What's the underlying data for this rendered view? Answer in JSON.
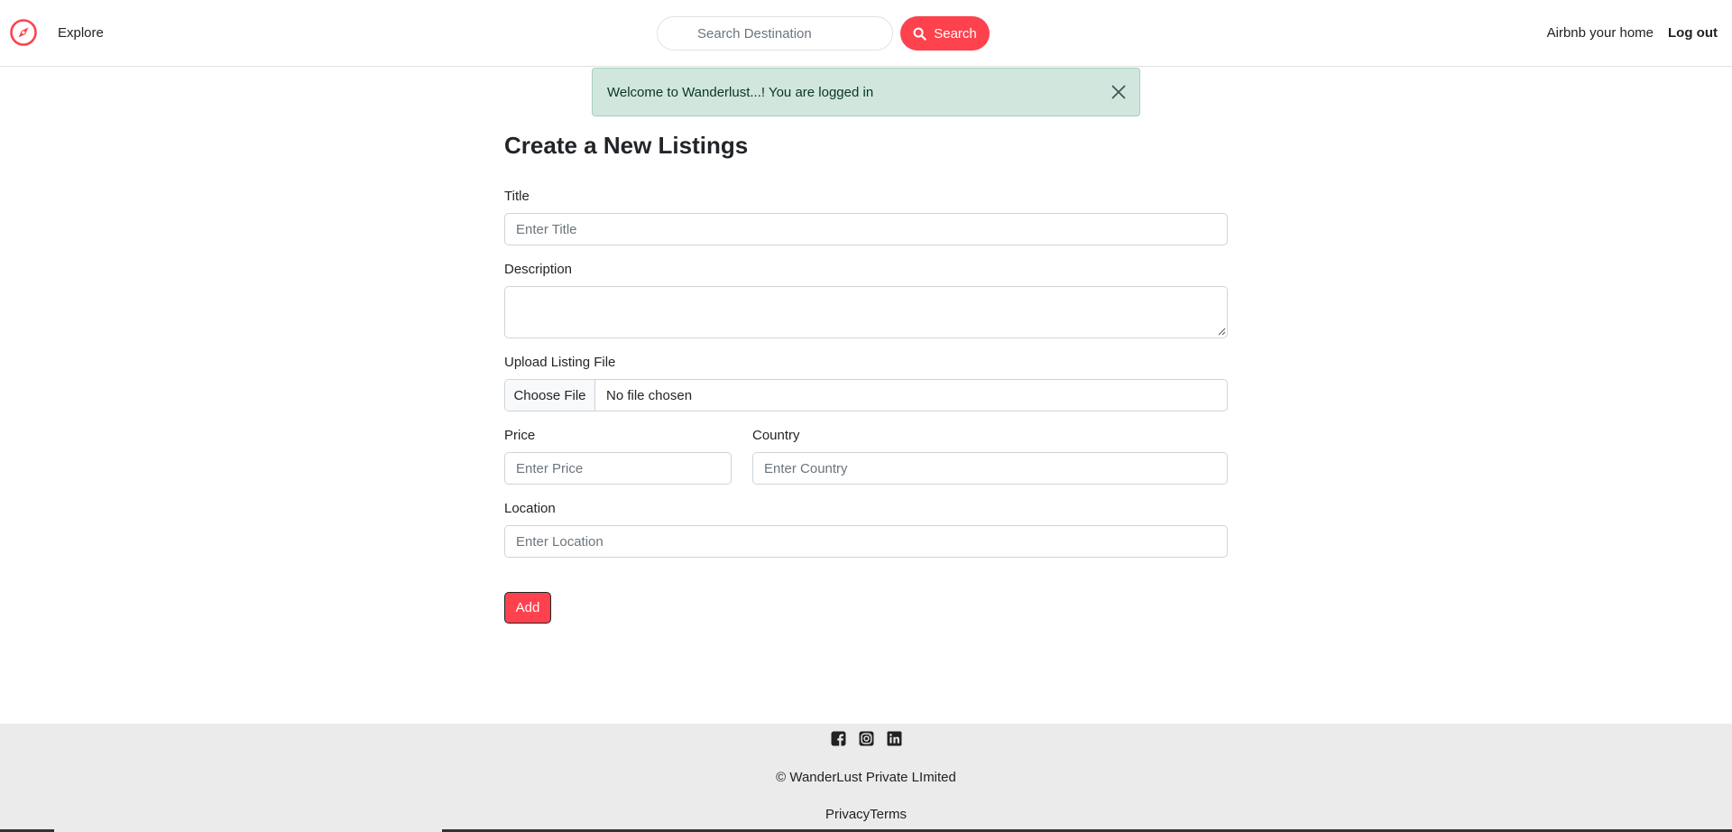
{
  "navbar": {
    "explore_label": "Explore",
    "search_placeholder": "Search Destination",
    "search_button_label": "Search",
    "airbnb_label": "Airbnb your home",
    "logout_label": "Log out",
    "brand_icon": "compass-icon"
  },
  "alert": {
    "message": "Welcome to Wanderlust...! You are logged in"
  },
  "form": {
    "title": "Create a New Listings",
    "title_label": "Title",
    "title_placeholder": "Enter Title",
    "description_label": "Description",
    "upload_label": "Upload Listing File",
    "choose_file_label": "Choose File",
    "file_status": "No file chosen",
    "price_label": "Price",
    "price_placeholder": "Enter Price",
    "country_label": "Country",
    "country_placeholder": "Enter Country",
    "location_label": "Location",
    "location_placeholder": "Enter Location",
    "submit_label": "Add"
  },
  "footer": {
    "social_icons": [
      "facebook-icon",
      "instagram-icon",
      "linkedin-icon"
    ],
    "copyright": "© WanderLust Private LImited",
    "privacy_label": "Privacy",
    "terms_label": "Terms"
  },
  "colors": {
    "accent": "#fe424d",
    "alert_bg": "#d1e7dd",
    "footer_bg": "#ebebeb"
  }
}
